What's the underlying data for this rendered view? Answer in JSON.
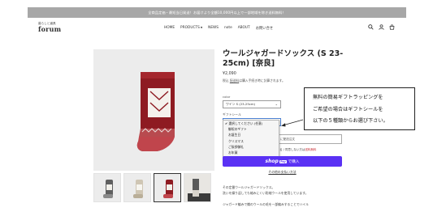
{
  "announcement": "全商品定価・最短当日発送！お届けより全額10,000円以上で一部地域を除き送料無料！",
  "brand": {
    "sub": "暮らしと道具",
    "name": "forum"
  },
  "nav": {
    "home": "HOME",
    "products": "PRODUCTS",
    "news": "NEWS",
    "note": "note",
    "about": "ABOUT",
    "contact": "お問い合せ"
  },
  "header_icons": [
    "search-icon",
    "user-icon",
    "cart-icon"
  ],
  "product": {
    "title": "ウールジャガードソックス (S 23-25cm) [奈良]",
    "price": "¥2,090",
    "tax_note_prefix": "税込",
    "tax_link": "配送料",
    "tax_note_suffix": "は購入手続き時に計算されます。"
  },
  "color": {
    "label": "color",
    "value": "ワイン S (23-25cm)"
  },
  "gift": {
    "label": "ギフトシール",
    "value": "選択してください (任意)",
    "options": [
      "選択してください (任意)",
      "御祝のギフト",
      "お誕生日",
      "クリスマス",
      "ご挨拶御礼",
      "お年賀"
    ],
    "selected_index": 0,
    "field_note": "に配送注文",
    "agree_prefix": "利用規約に同意する / 同意しない方は",
    "agree_red": "送料無料"
  },
  "buy": {
    "shop": "shop",
    "pay": "Pay",
    "label": "で購入"
  },
  "more_payment": "その他の支払い方法",
  "description": {
    "line1": "その定番ウールジャガードソックス。",
    "line2": "洗いを繰り返しても縮みにくい防縮ウールを使用しています。",
    "line3": "ジャガード編みで織のウールの毛を一部編みすることでハイル"
  },
  "callout": {
    "line1": "無料の簡易ギフトラッピングを",
    "line2": "ご希望の場合はギフトシールを",
    "line3": "以下の５種類からお選び下さい。"
  },
  "colors": {
    "sock_red": "#8e1b22",
    "buy_button": "#5a31f4",
    "announce_bg": "#a7a7a7"
  }
}
